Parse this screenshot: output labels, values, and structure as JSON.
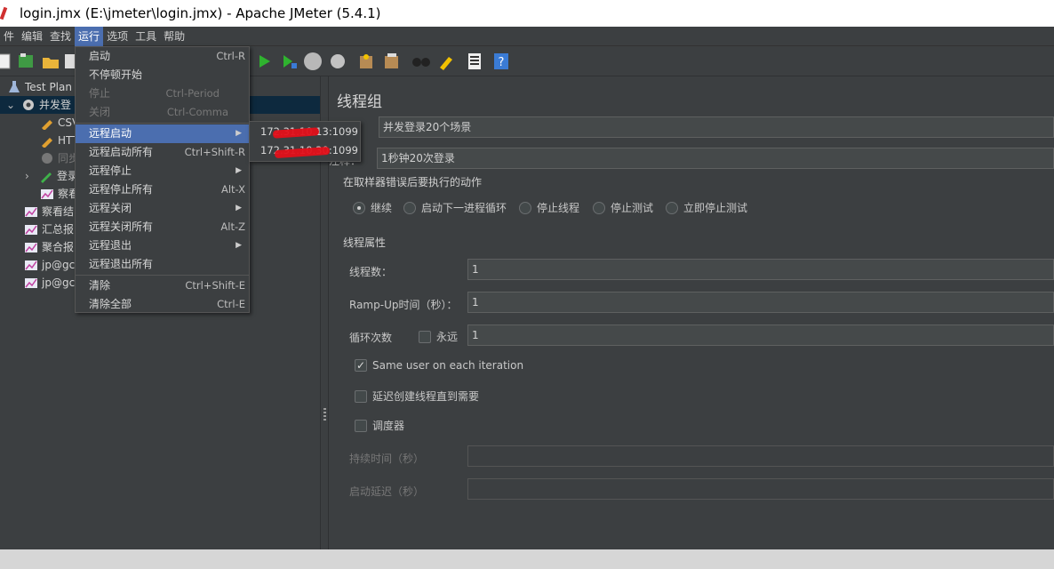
{
  "window": {
    "title": "login.jmx (E:\\jmeter\\login.jmx) - Apache JMeter (5.4.1)"
  },
  "menubar": [
    "件",
    "编辑",
    "查找",
    "运行",
    "选项",
    "工具",
    "帮助"
  ],
  "run_menu": {
    "items": [
      {
        "label": "启动",
        "shortcut": "Ctrl-R"
      },
      {
        "label": "不停顿开始",
        "shortcut": ""
      },
      {
        "label": "停止",
        "shortcut": "Ctrl-Period"
      },
      {
        "label": "关闭",
        "shortcut": "Ctrl-Comma"
      },
      {
        "label": "远程启动",
        "shortcut": ""
      },
      {
        "label": "远程启动所有",
        "shortcut": "Ctrl+Shift-R"
      },
      {
        "label": "远程停止",
        "shortcut": ""
      },
      {
        "label": "远程停止所有",
        "shortcut": "Alt-X"
      },
      {
        "label": "远程关闭",
        "shortcut": ""
      },
      {
        "label": "远程关闭所有",
        "shortcut": "Alt-Z"
      },
      {
        "label": "远程退出",
        "shortcut": ""
      },
      {
        "label": "远程退出所有",
        "shortcut": ""
      },
      {
        "label": "清除",
        "shortcut": "Ctrl+Shift-E"
      },
      {
        "label": "清除全部",
        "shortcut": "Ctrl-E"
      }
    ],
    "submenu_arrow": "▶"
  },
  "remote_submenu": [
    "172.31.10.13:1099",
    "172.31.10.30:1099"
  ],
  "tree": {
    "test_plan": "Test Plan",
    "thread_group": "并发登",
    "csv": "CSV",
    "http": "HTT",
    "sync": "同步",
    "login": "登录",
    "view1": "察看",
    "view_results": "察看结",
    "summary": "汇总报",
    "aggregate": "聚合报",
    "jp1": "jp@gc",
    "jp2": "jp@gc"
  },
  "panel": {
    "title": "线程组",
    "name_label": "：",
    "name_value": "并发登录20个场景",
    "comment_label": "注释：",
    "comment_value": "1秒钟20次登录",
    "error_action_title": "在取样器错误后要执行的动作",
    "error_actions": [
      "继续",
      "启动下一进程循环",
      "停止线程",
      "停止测试",
      "立即停止测试"
    ],
    "thread_props_title": "线程属性",
    "threads_label": "线程数：",
    "threads_value": "1",
    "rampup_label": "Ramp-Up时间（秒）：",
    "rampup_value": "1",
    "loop_label": "循环次数",
    "forever_label": "永远",
    "loop_value": "1",
    "same_user_label": "Same user on each iteration",
    "delay_label": "延迟创建线程直到需要",
    "scheduler_label": "调度器",
    "duration_label": "持续时间（秒）",
    "startup_delay_label": "启动延迟（秒）"
  }
}
